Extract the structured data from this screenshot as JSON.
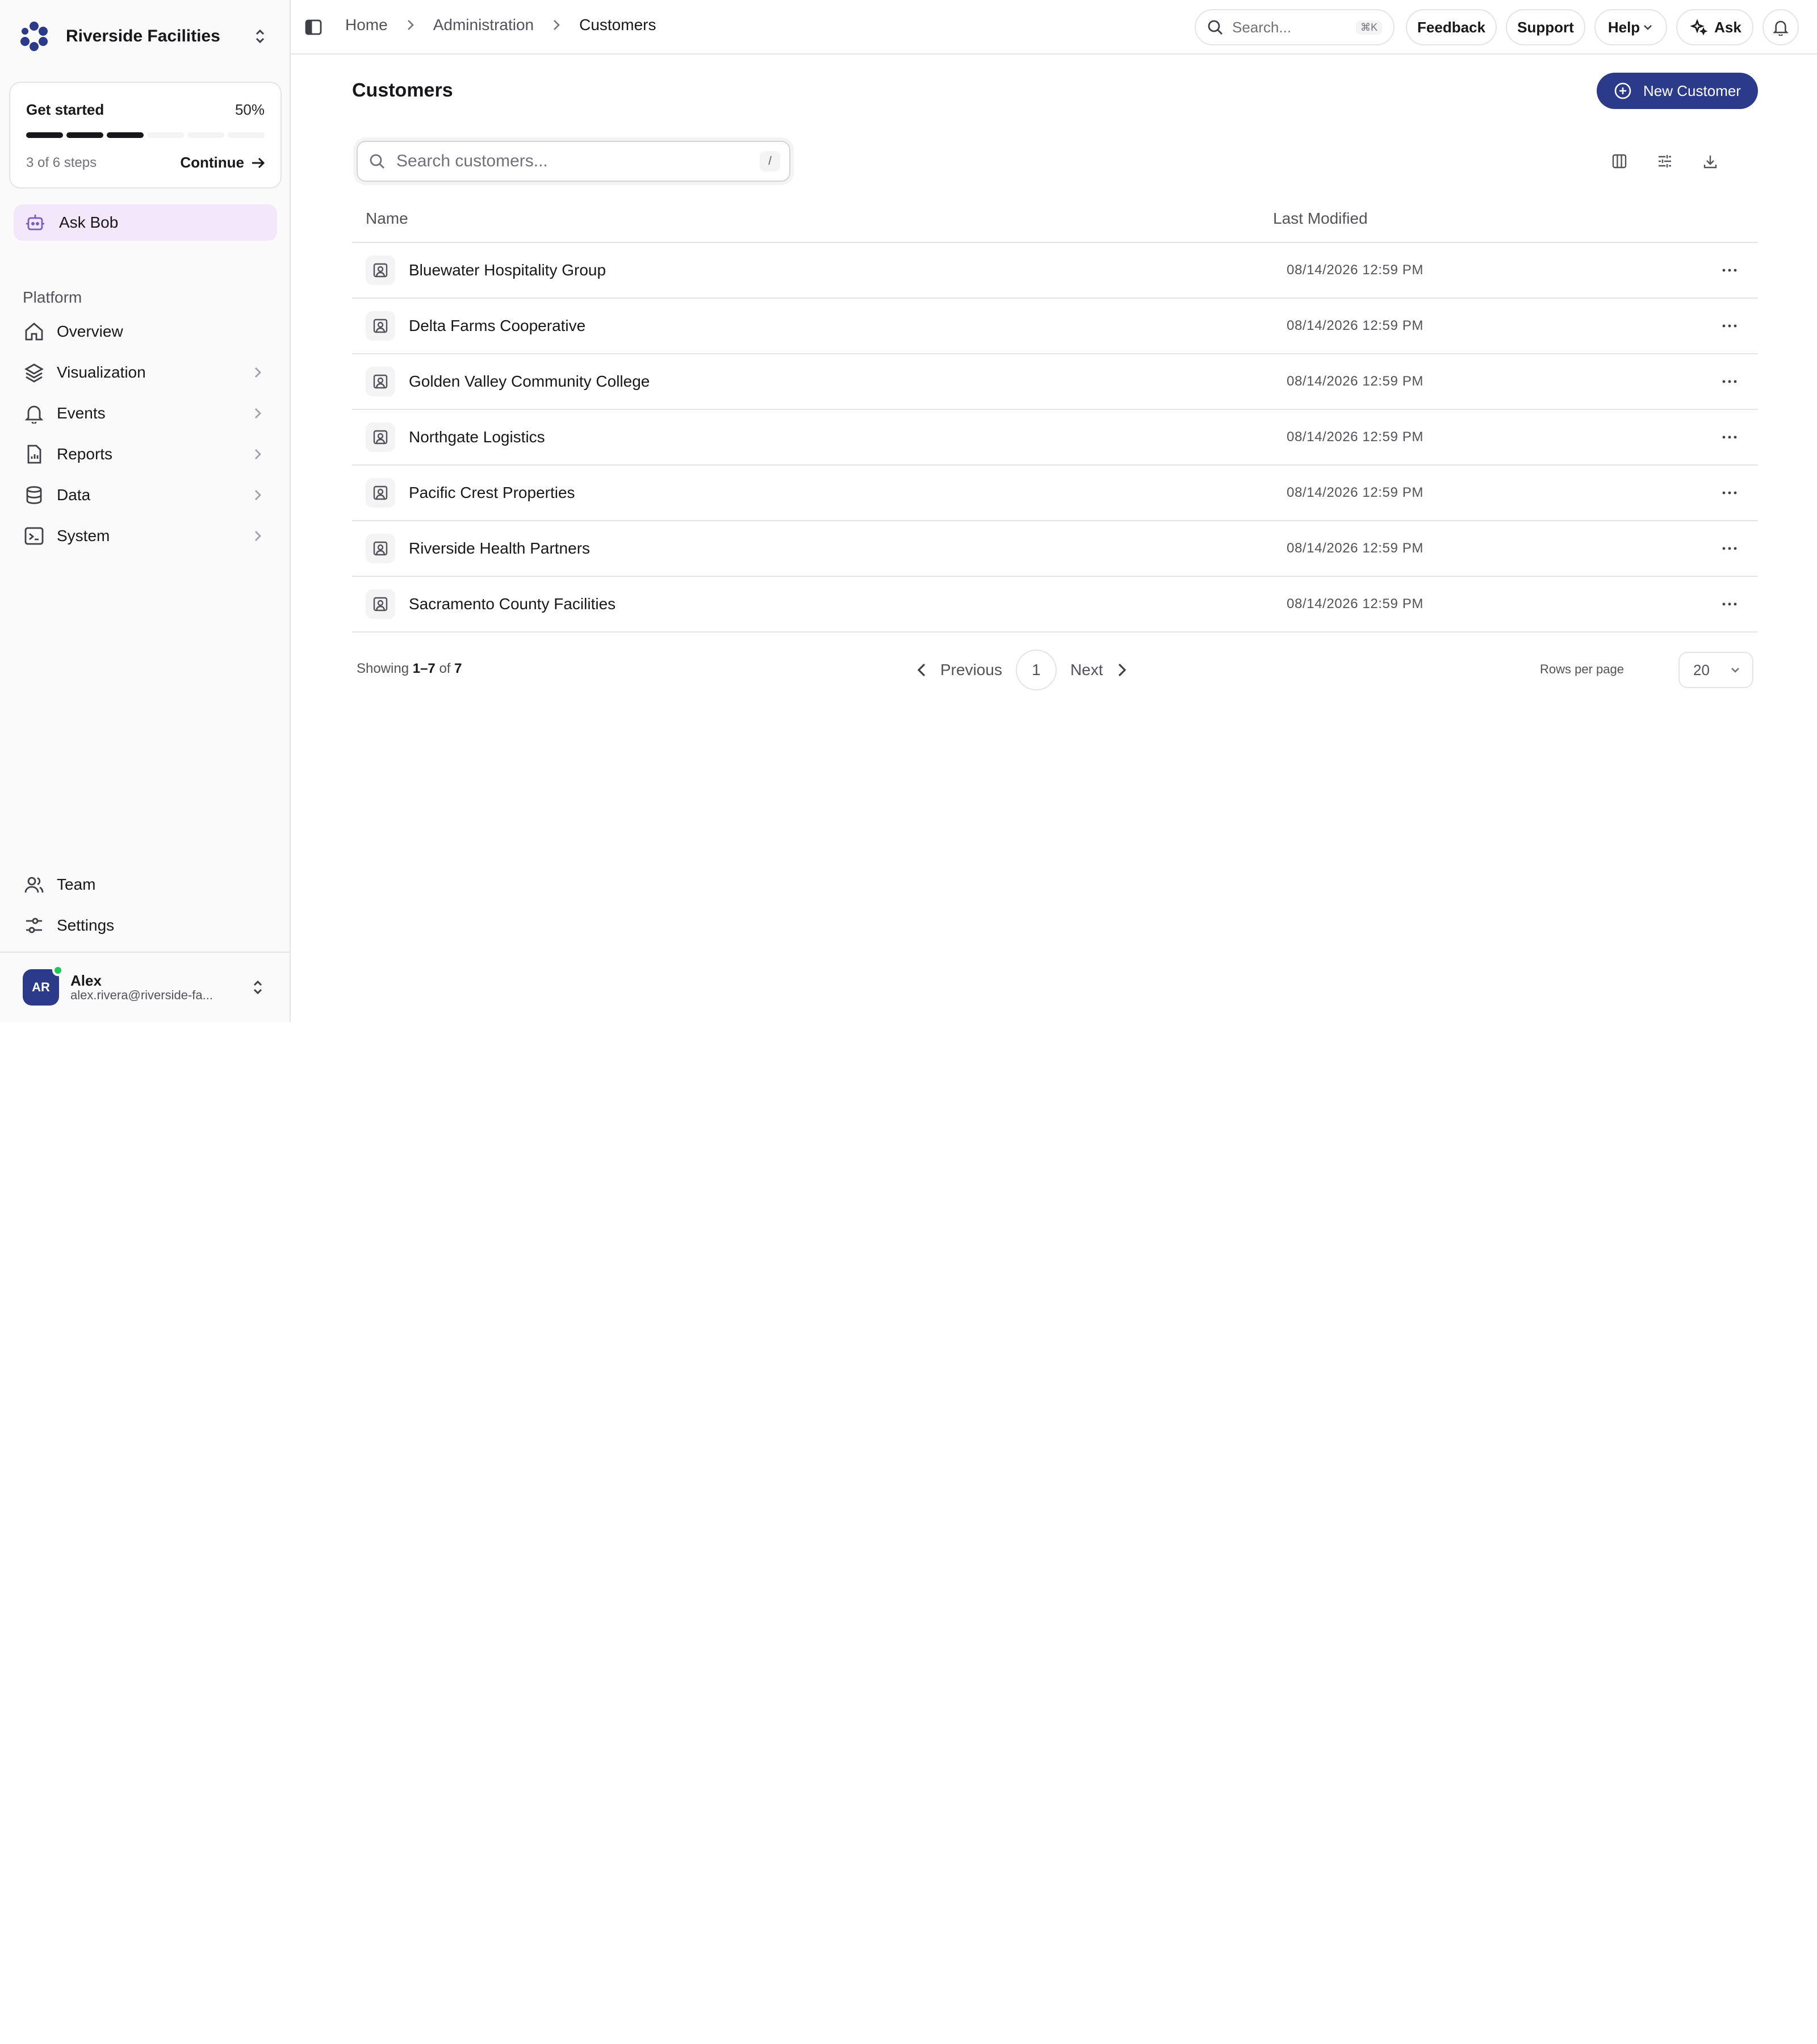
{
  "org": {
    "name": "Riverside Facilities"
  },
  "get_started": {
    "title": "Get started",
    "percent": "50%",
    "progress": 0.5,
    "steps_text": "3 of 6 steps",
    "continue_label": "Continue"
  },
  "ask_bob": {
    "label": "Ask Bob"
  },
  "sidebar": {
    "section_label": "Platform",
    "items": [
      {
        "label": "Overview",
        "icon": "home-icon"
      },
      {
        "label": "Visualization",
        "icon": "layers-icon"
      },
      {
        "label": "Events",
        "icon": "bell-icon"
      },
      {
        "label": "Reports",
        "icon": "file-chart-icon"
      },
      {
        "label": "Data",
        "icon": "database-icon"
      },
      {
        "label": "System",
        "icon": "terminal-icon"
      }
    ],
    "bottom_items": [
      {
        "label": "Team",
        "icon": "users-icon"
      },
      {
        "label": "Settings",
        "icon": "sliders-icon"
      }
    ]
  },
  "user": {
    "initials": "AR",
    "name": "Alex",
    "email": "alex.rivera@riverside-fa..."
  },
  "breadcrumb": {
    "home": "Home",
    "admin": "Administration",
    "current": "Customers"
  },
  "topbar": {
    "search_placeholder": "Search...",
    "search_shortcut": "⌘K",
    "feedback": "Feedback",
    "support": "Support",
    "help": "Help",
    "ask": "Ask"
  },
  "page": {
    "title": "Customers",
    "new_button": "New Customer",
    "search_placeholder": "Search customers...",
    "search_shortcut": "/"
  },
  "table": {
    "columns": {
      "name": "Name",
      "modified": "Last Modified"
    },
    "rows": [
      {
        "name": "Bluewater Hospitality Group",
        "modified": "08/14/2026 12:59 PM"
      },
      {
        "name": "Delta Farms Cooperative",
        "modified": "08/14/2026 12:59 PM"
      },
      {
        "name": "Golden Valley Community College",
        "modified": "08/14/2026 12:59 PM"
      },
      {
        "name": "Northgate Logistics",
        "modified": "08/14/2026 12:59 PM"
      },
      {
        "name": "Pacific Crest Properties",
        "modified": "08/14/2026 12:59 PM"
      },
      {
        "name": "Riverside Health Partners",
        "modified": "08/14/2026 12:59 PM"
      },
      {
        "name": "Sacramento County Facilities",
        "modified": "08/14/2026 12:59 PM"
      }
    ]
  },
  "pagination": {
    "showing_prefix": "Showing",
    "range": "1–7",
    "of": "of",
    "total": "7",
    "previous": "Previous",
    "page": "1",
    "next": "Next",
    "rows_per_page_label": "Rows per page",
    "rows_per_page": "20"
  },
  "colors": {
    "accent": "#2c3a8a",
    "ask_bob_bg": "#f3e8fa",
    "online": "#22c55e"
  }
}
